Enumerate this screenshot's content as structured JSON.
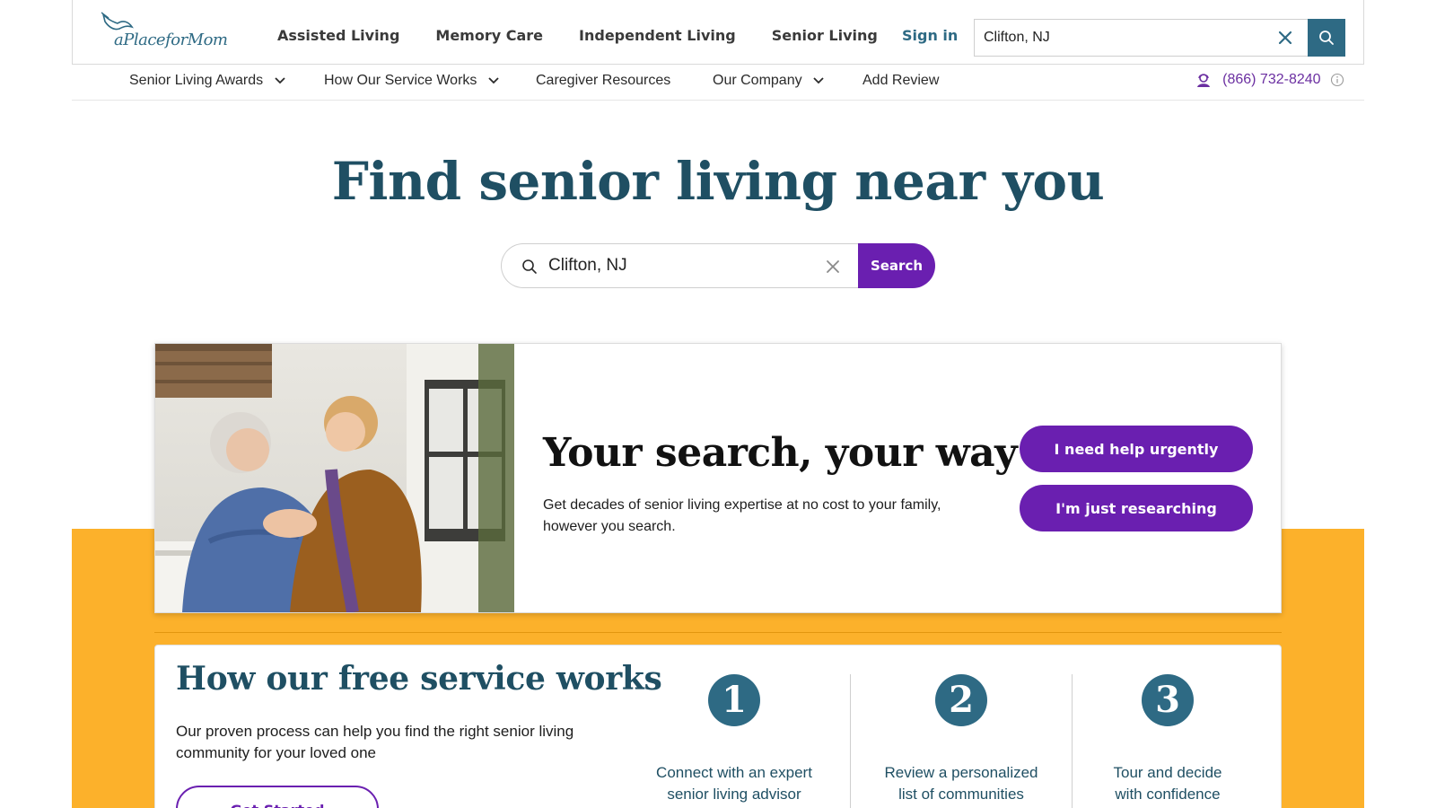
{
  "brand": {
    "logo_text": "aPlaceforMom",
    "accent": "#2e6a84",
    "purple": "#6a1fb0",
    "orange": "#fcb12b"
  },
  "header": {
    "nav": [
      "Assisted Living",
      "Memory Care",
      "Independent Living",
      "Senior Living"
    ],
    "signin_label": "Sign in",
    "search_value": "Clifton, NJ"
  },
  "subnav": {
    "items": [
      {
        "label": "Senior Living Awards",
        "dropdown": true
      },
      {
        "label": "How Our Service Works",
        "dropdown": true
      },
      {
        "label": "Caregiver Resources",
        "dropdown": false
      },
      {
        "label": "Our Company",
        "dropdown": true
      },
      {
        "label": "Add Review",
        "dropdown": false
      }
    ],
    "phone": "(866) 732-8240"
  },
  "hero": {
    "title": "Find senior living near you",
    "search_value": "Clifton, NJ",
    "search_button": "Search"
  },
  "card": {
    "title": "Your search, your way",
    "text": "Get decades of senior living expertise at no cost to your family, however you search.",
    "btn_urgent": "I need help urgently",
    "btn_research": "I'm just researching"
  },
  "service": {
    "title": "How our free service works",
    "text": "Our proven process can help you find the right senior living community for your loved one",
    "cta": "Get Started",
    "steps": [
      {
        "num": "1",
        "caption_line1": "Connect with an expert",
        "caption_line2": "senior living advisor"
      },
      {
        "num": "2",
        "caption_line1": "Review a personalized",
        "caption_line2": "list of communities"
      },
      {
        "num": "3",
        "caption_line1": "Tour and decide",
        "caption_line2": "with confidence"
      }
    ]
  }
}
